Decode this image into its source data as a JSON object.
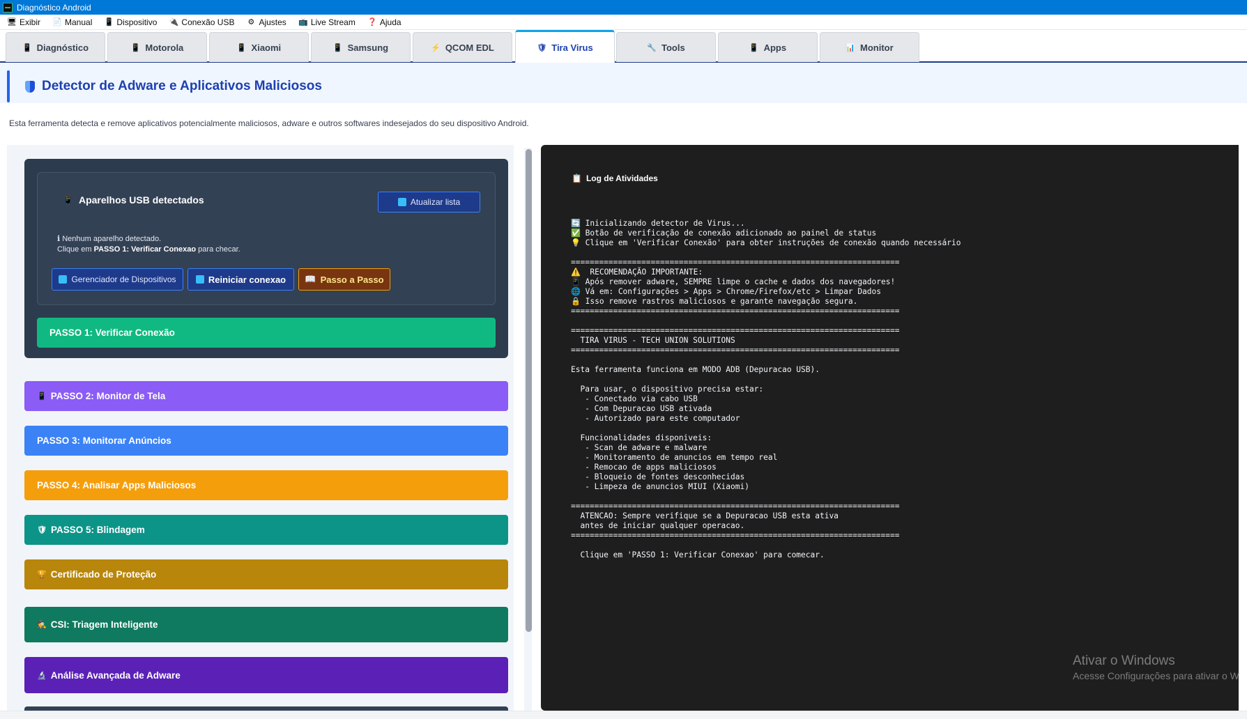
{
  "window": {
    "title": "Diagnóstico Android"
  },
  "menu": [
    {
      "label": "Exibir",
      "icon": "🖥"
    },
    {
      "label": "Manual",
      "icon": "📄"
    },
    {
      "label": "Dispositivo",
      "icon": "📱"
    },
    {
      "label": "Conexão USB",
      "icon": "🔌"
    },
    {
      "label": "Ajustes",
      "icon": "⚙"
    },
    {
      "label": "Live Stream",
      "icon": "📺"
    },
    {
      "label": "Ajuda",
      "icon": "❓"
    }
  ],
  "tabs": [
    {
      "label": "Diagnóstico",
      "icon": "📱"
    },
    {
      "label": "Motorola",
      "icon": "📱"
    },
    {
      "label": "Xiaomi",
      "icon": "📱"
    },
    {
      "label": "Samsung",
      "icon": "📱"
    },
    {
      "label": "QCOM EDL",
      "icon": "⚡"
    },
    {
      "label": "Tira Virus",
      "icon": "🛡"
    },
    {
      "label": "Tools",
      "icon": "🔧"
    },
    {
      "label": "Apps",
      "icon": "📱"
    },
    {
      "label": "Monitor",
      "icon": "📊"
    }
  ],
  "active_tab": "Tira Virus",
  "header": {
    "title": "Detector de Adware e Aplicativos Maliciosos",
    "description": "Esta ferramenta detecta e remove aplicativos potencialmente maliciosos, adware e outros softwares indesejados do seu dispositivo Android."
  },
  "usb": {
    "title": "Aparelhos USB detectados",
    "refresh_label": "Atualizar lista",
    "no_device_line1": "ℹ Nenhum aparelho detectado.",
    "no_device_line2_prefix": "Clique em ",
    "no_device_line2_bold": "PASSO 1: Verificar Conexao",
    "no_device_line2_suffix": " para checar.",
    "btn_manager": "Gerenciador de Dispositivos",
    "btn_restart": "Reiniciar conexao",
    "btn_step_by_step": "Passo a Passo"
  },
  "steps": {
    "step1": "PASSO 1: Verificar Conexão",
    "step2": "PASSO 2: Monitor de Tela",
    "step3": "PASSO 3: Monitorar Anúncios",
    "step4": "PASSO 4: Analisar Apps Maliciosos",
    "step5": "PASSO 5: Blindagem",
    "step6": "Certificado de Proteção",
    "step7": "CSI: Triagem Inteligente",
    "step8": "Análise Avançada de Adware"
  },
  "log": {
    "title": "Log de Atividades",
    "lines": [
      "🔄 Inicializando detector de Virus...",
      "✅ Botão de verificação de conexão adicionado ao painel de status",
      "💡 Clique em 'Verificar Conexão' para obter instruções de conexão quando necessário",
      "",
      "======================================================================",
      "⚠️  RECOMENDAÇÃO IMPORTANTE:",
      "📱 Após remover adware, SEMPRE limpe o cache e dados dos navegadores!",
      "🌐 Vá em: Configurações > Apps > Chrome/Firefox/etc > Limpar Dados",
      "🔒 Isso remove rastros maliciosos e garante navegação segura.",
      "======================================================================",
      "",
      "======================================================================",
      "  TIRA VIRUS - TECH UNION SOLUTIONS",
      "======================================================================",
      "",
      "Esta ferramenta funciona em MODO ADB (Depuracao USB).",
      "",
      "  Para usar, o dispositivo precisa estar:",
      "   - Conectado via cabo USB",
      "   - Com Depuracao USB ativada",
      "   - Autorizado para este computador",
      "",
      "  Funcionalidades disponiveis:",
      "   - Scan de adware e malware",
      "   - Monitoramento de anuncios em tempo real",
      "   - Remocao de apps maliciosos",
      "   - Bloqueio de fontes desconhecidas",
      "   - Limpeza de anuncios MIUI (Xiaomi)",
      "",
      "======================================================================",
      "  ATENCAO: Sempre verifique se a Depuracao USB esta ativa",
      "  antes de iniciar qualquer operacao.",
      "======================================================================",
      "",
      "  Clique em 'PASSO 1: Verificar Conexao' para comecar."
    ]
  },
  "watermark": {
    "line1": "Ativar o Windows",
    "line2": "Acesse Configurações para ativar o W"
  },
  "colors": {
    "titlebar": "#0078d7",
    "accent": "#2563eb",
    "step1": "#10b981",
    "step2": "#8b5cf6",
    "step3": "#3b82f6",
    "step4": "#f59e0b",
    "step5": "#0d9488",
    "step6": "#b8860b",
    "step7": "#0f7a5f",
    "step8": "#5b21b6",
    "log_bg": "#1e1e1e"
  }
}
